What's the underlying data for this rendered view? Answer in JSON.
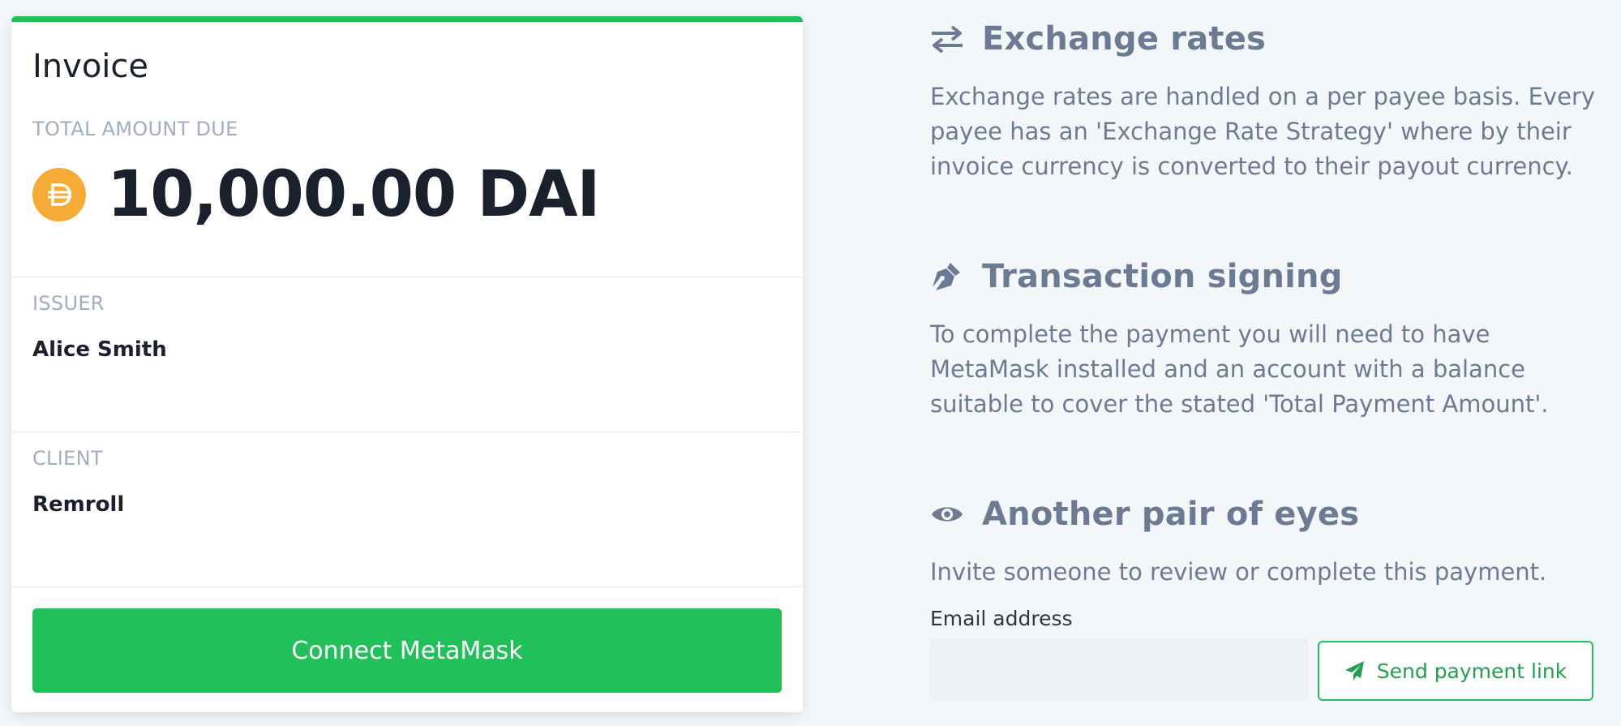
{
  "invoice": {
    "title": "Invoice",
    "total_label": "TOTAL AMOUNT DUE",
    "amount": "10,000.00 DAI",
    "token_icon": "dai-icon",
    "issuer_label": "ISSUER",
    "issuer_name": "Alice Smith",
    "client_label": "CLIENT",
    "client_name": "Remroll",
    "connect_button": "Connect MetaMask",
    "accent_color": "#22c05a",
    "token_color": "#f5ac37"
  },
  "info": {
    "exchange": {
      "icon": "exchange-arrows-icon",
      "title": "Exchange rates",
      "text": "Exchange rates are handled on a per payee basis. Every payee has an 'Exchange Rate Strategy' where by their invoice currency is converted to their payout currency."
    },
    "signing": {
      "icon": "pen-nib-icon",
      "title": "Transaction signing",
      "text": "To complete the payment you will need to have MetaMask installed and an account with a balance suitable to cover the stated 'Total Payment Amount'."
    },
    "review": {
      "icon": "eye-icon",
      "title": "Another pair of eyes",
      "text": "Invite someone to review or complete this payment.",
      "email_label": "Email address",
      "email_value": "",
      "send_button": "Send payment link",
      "send_icon": "paper-plane-icon"
    }
  },
  "text_color": "#6c7b94"
}
